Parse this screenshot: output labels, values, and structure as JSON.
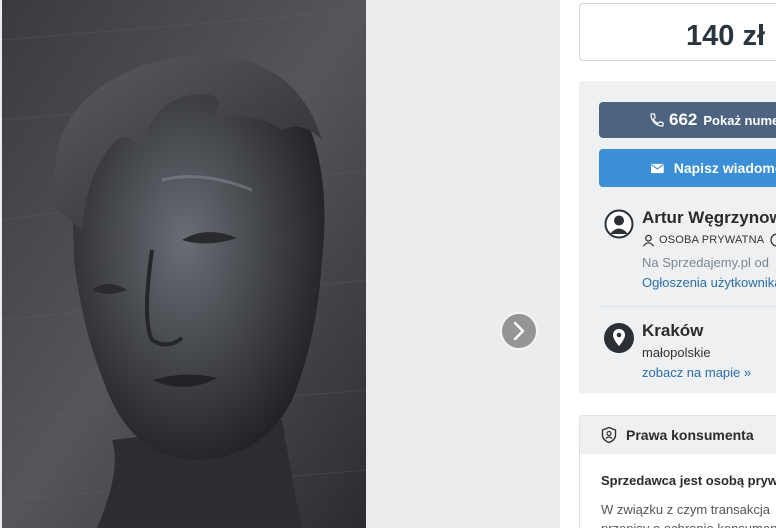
{
  "gallery": {
    "image_subject": "sculpture-head",
    "next_icon": "chevron-right-icon"
  },
  "price": {
    "value": "140 zł"
  },
  "contact": {
    "phone_icon": "phone-icon",
    "phone_prefix": "662",
    "phone_label": "Pokaż numer",
    "message_icon": "envelope-icon",
    "message_label": "Napisz wiadomość"
  },
  "seller": {
    "avatar_icon": "user-avatar-icon",
    "name": "Artur Węgrzynowicz",
    "type_icon": "person-icon",
    "type": "OSOBA PRYWATNA",
    "info_icon": "info-icon",
    "since": "Na Sprzedajemy.pl od",
    "ads_link": "Ogłoszenia użytkownika"
  },
  "location": {
    "icon": "map-pin-icon",
    "city": "Kraków",
    "region": "małopolskie",
    "map_link": "zobacz na mapie »"
  },
  "consumer": {
    "icon": "shield-icon",
    "title": "Prawa konsumenta",
    "bold_text": "Sprzedawca jest osobą prywatną",
    "text_line1": "W związku z czym transakcja",
    "text_line2": "przepisy o ochronie konsumenta"
  },
  "colors": {
    "primary_button": "#4d6380",
    "message_button": "#3a8fd6",
    "link": "#2c6ea8",
    "panel_bg": "#eef0f2"
  }
}
